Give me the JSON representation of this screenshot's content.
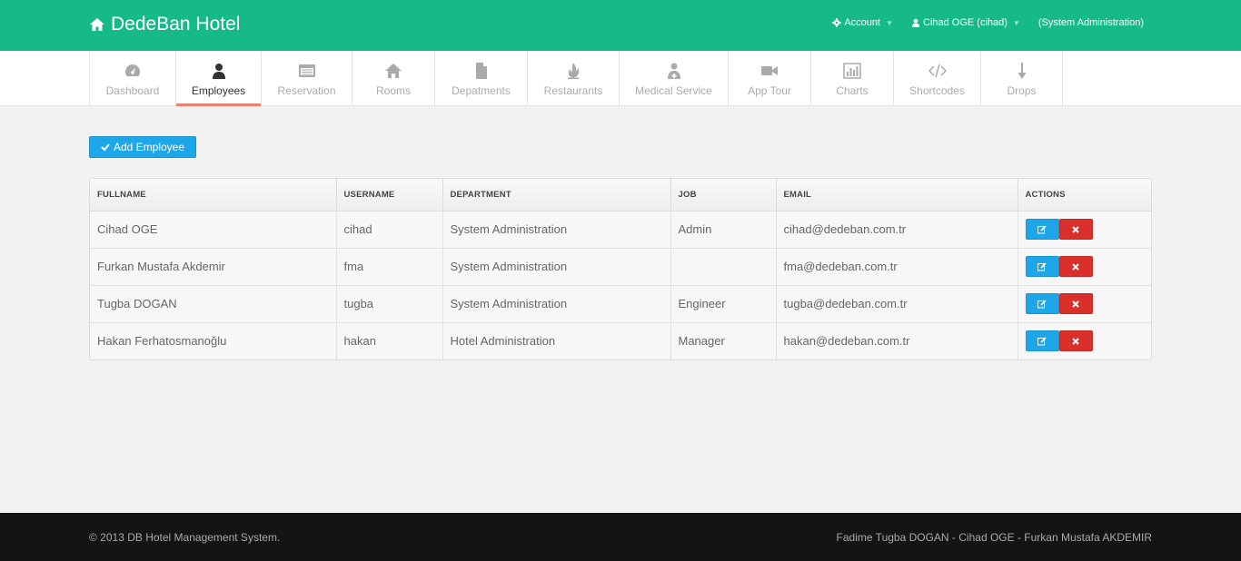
{
  "header": {
    "brand": "DedeBan Hotel",
    "account_label": "Account",
    "user_label": "Cihad OGE (cihad)",
    "role_label": "(System Administration)"
  },
  "tabs": [
    {
      "label": "Dashboard",
      "icon": "dashboard-icon"
    },
    {
      "label": "Employees",
      "icon": "user-icon",
      "active": true
    },
    {
      "label": "Reservation",
      "icon": "calendar-icon"
    },
    {
      "label": "Rooms",
      "icon": "home-icon"
    },
    {
      "label": "Depatments",
      "icon": "file-icon"
    },
    {
      "label": "Restaurants",
      "icon": "fire-icon"
    },
    {
      "label": "Medical Service",
      "icon": "medic-icon"
    },
    {
      "label": "App Tour",
      "icon": "video-icon"
    },
    {
      "label": "Charts",
      "icon": "chart-icon"
    },
    {
      "label": "Shortcodes",
      "icon": "code-icon"
    },
    {
      "label": "Drops",
      "icon": "arrow-down-icon"
    }
  ],
  "toolbar": {
    "add_label": "Add Employee"
  },
  "table": {
    "columns": [
      "FULLNAME",
      "USERNAME",
      "DEPARTMENT",
      "JOB",
      "EMAIL",
      "ACTIONS"
    ],
    "rows": [
      {
        "fullname": "Cihad OGE",
        "username": "cihad",
        "department": "System Administration",
        "job": "Admin",
        "email": "cihad@dedeban.com.tr"
      },
      {
        "fullname": "Furkan Mustafa Akdemir",
        "username": "fma",
        "department": "System Administration",
        "job": "",
        "email": "fma@dedeban.com.tr"
      },
      {
        "fullname": "Tugba DOGAN",
        "username": "tugba",
        "department": "System Administration",
        "job": "Engineer",
        "email": "tugba@dedeban.com.tr"
      },
      {
        "fullname": "Hakan Ferhatosmanoğlu",
        "username": "hakan",
        "department": "Hotel Administration",
        "job": "Manager",
        "email": "hakan@dedeban.com.tr"
      }
    ]
  },
  "footer": {
    "copyright": "© 2013 DB Hotel Management System.",
    "authors": "Fadime Tugba DOGAN - Cihad OGE - Furkan Mustafa AKDEMIR"
  },
  "colors": {
    "primary": "#16b988",
    "accent": "#1ea7e8",
    "danger": "#d9302c",
    "active_tab": "#f0816f"
  }
}
